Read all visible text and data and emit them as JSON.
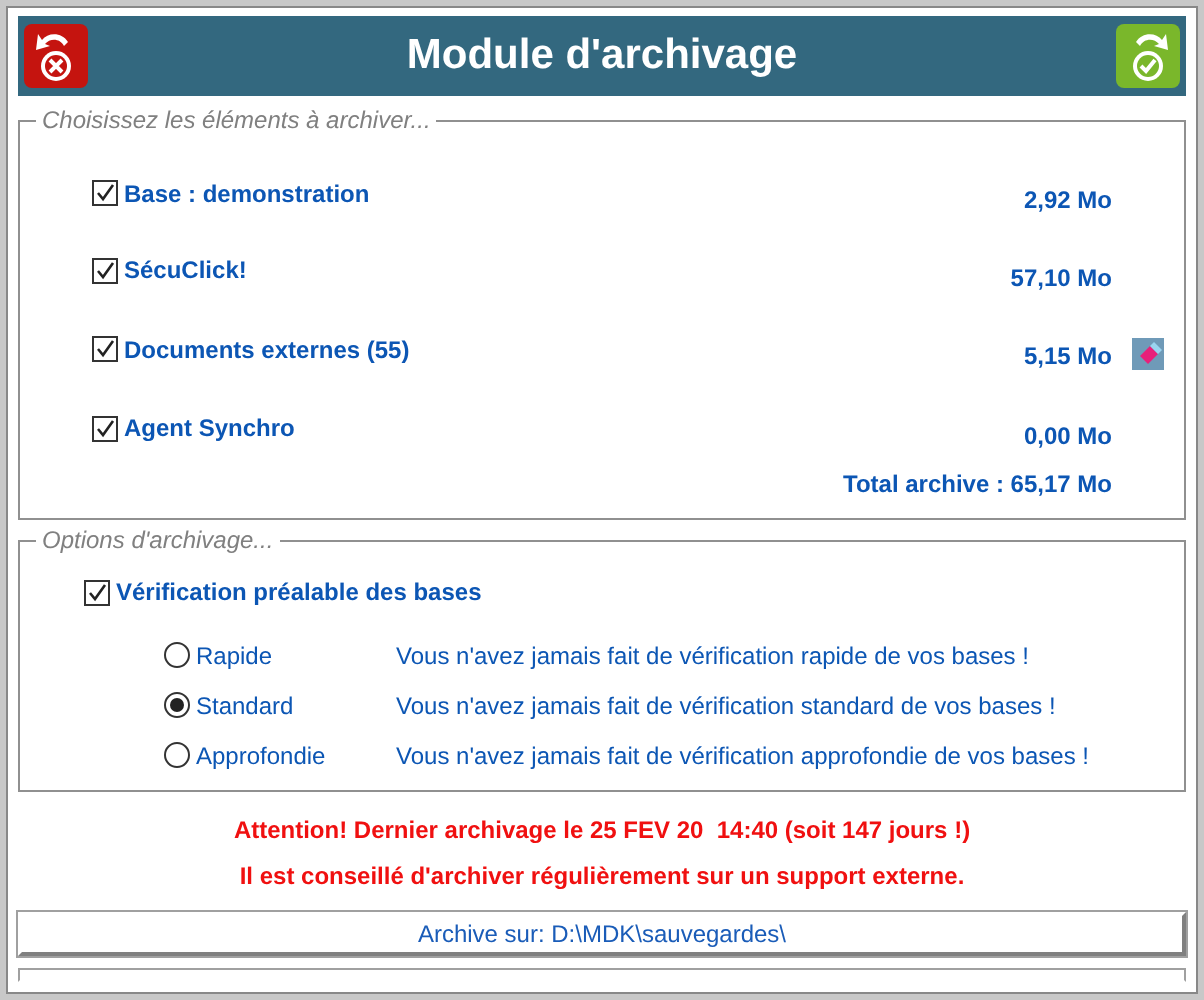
{
  "window": {
    "title": "Module d'archivage"
  },
  "elements": {
    "legend": "Choisissez les éléments à archiver...",
    "items": [
      {
        "label": "Base : demonstration",
        "size": "2,92 Mo",
        "checked": true
      },
      {
        "label": "SécuClick!",
        "size": "57,10 Mo",
        "checked": true
      },
      {
        "label": "Documents externes (55)",
        "size": "5,15 Mo",
        "checked": true,
        "eraser": true
      },
      {
        "label": "Agent Synchro",
        "size": "0,00 Mo",
        "checked": true
      }
    ],
    "total": "Total archive : 65,17 Mo"
  },
  "options": {
    "legend": "Options d'archivage...",
    "verify": {
      "label": "Vérification préalable des bases",
      "checked": true
    },
    "modes": [
      {
        "label": "Rapide",
        "selected": false,
        "message": "Vous n'avez jamais fait de vérification rapide de vos bases !"
      },
      {
        "label": "Standard",
        "selected": true,
        "message": "Vous n'avez jamais fait de vérification standard de vos bases !"
      },
      {
        "label": "Approfondie",
        "selected": false,
        "message": "Vous n'avez jamais fait de vérification approfondie de vos bases !"
      }
    ]
  },
  "warnings": [
    "Attention! Dernier archivage le 25 FEV 20  14:40 (soit 147 jours !)",
    "Il est conseillé d'archiver régulièrement sur un support externe."
  ],
  "destination": "Archive sur: D:\\MDK\\sauvegardes\\"
}
